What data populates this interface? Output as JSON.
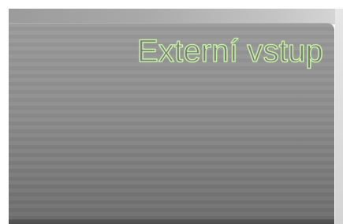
{
  "panel": {
    "title": "Externí vstup"
  },
  "colors": {
    "title_outline": "#c9f3a6",
    "panel_top": "#9a9a9a",
    "panel_bottom": "#6e6e6e"
  }
}
